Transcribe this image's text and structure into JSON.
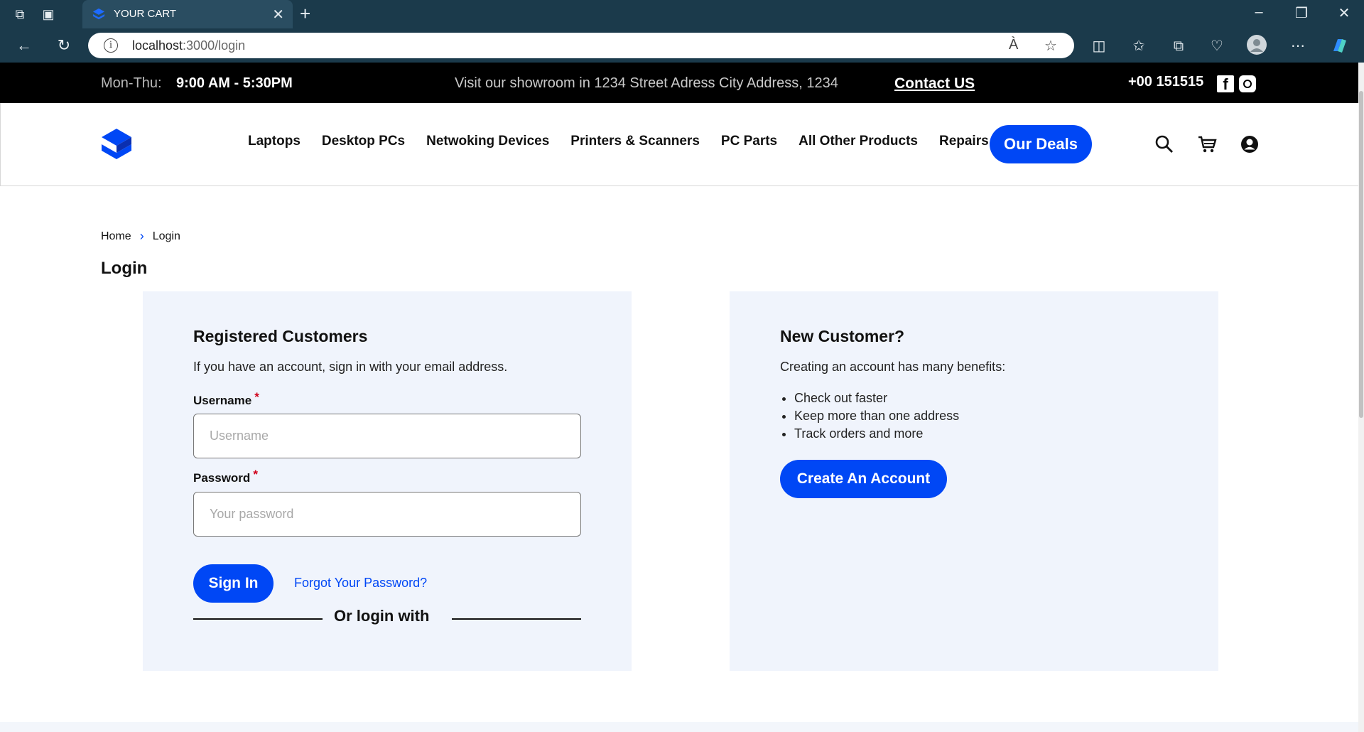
{
  "browser": {
    "tab_title": "YOUR CART",
    "url_host": "localhost",
    "url_path": ":3000/login"
  },
  "topbar": {
    "hours_label": "Mon-Thu:",
    "hours": "9:00 AM - 5:30PM",
    "showroom": "Visit our showroom in 1234 Street Adress City Address, 1234",
    "contact": "Contact US",
    "phone": "+00 151515"
  },
  "nav": {
    "items": [
      "Laptops",
      "Desktop PCs",
      "Netwoking Devices",
      "Printers & Scanners",
      "PC Parts",
      "All Other Products",
      "Repairs"
    ],
    "deals": "Our Deals"
  },
  "breadcrumb": {
    "home": "Home",
    "current": "Login"
  },
  "page_title": "Login",
  "registered": {
    "heading": "Registered Customers",
    "description": "If you have an account, sign in with your email address.",
    "username_label": "Username",
    "username_placeholder": "Username",
    "password_label": "Password",
    "password_placeholder": "Your password",
    "required_mark": "*",
    "sign_in": "Sign In",
    "forgot": "Forgot Your Password?",
    "or_login": "Or login with"
  },
  "new_customer": {
    "heading": "New Customer?",
    "description": "Creating an account has many benefits:",
    "benefits": [
      "Check out faster",
      "Keep more than one address",
      "Track orders and more"
    ],
    "create": "Create An Account"
  },
  "colors": {
    "accent": "#0047f5",
    "topbar": "#000000",
    "card": "#f0f4fc",
    "chrome": "#1b3a4b"
  },
  "icons": [
    "workspaces-icon",
    "tab-actions-icon",
    "site-favicon",
    "close-tab-icon",
    "new-tab-icon",
    "minimize-icon",
    "restore-icon",
    "close-window-icon",
    "back-icon",
    "refresh-icon",
    "site-info-icon",
    "read-aloud-icon",
    "favorite-star-icon",
    "split-screen-icon",
    "favorites-icon",
    "collections-icon",
    "browser-essentials-icon",
    "profile-icon",
    "more-icon",
    "copilot-icon",
    "facebook-icon",
    "instagram-icon",
    "search-icon",
    "cart-icon",
    "account-icon"
  ]
}
